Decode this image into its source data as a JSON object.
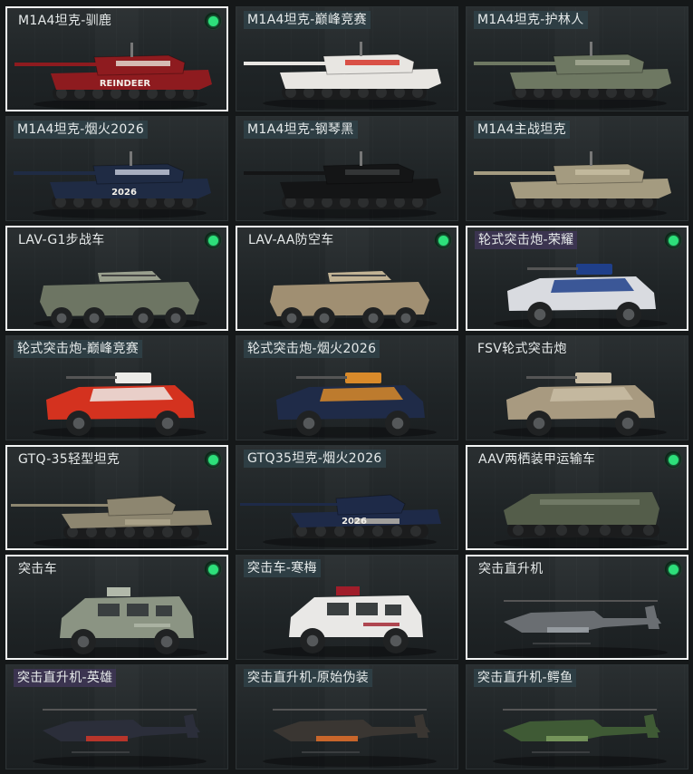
{
  "vehicles": [
    {
      "name": "M1A4坦克-驯鹿",
      "selected": true,
      "owned": true,
      "kind": "tank",
      "body": "#8e1b1f",
      "accent": "#e7e2d8",
      "tag": "plain"
    },
    {
      "name": "M1A4坦克-巅峰竞赛",
      "selected": false,
      "owned": false,
      "kind": "tank",
      "body": "#e8e6e2",
      "accent": "#d52a1f",
      "tag": "tagged"
    },
    {
      "name": "M1A4坦克-护林人",
      "selected": false,
      "owned": false,
      "kind": "tank",
      "body": "#6e7862",
      "accent": "#a7ad97",
      "tag": "tagged"
    },
    {
      "name": "M1A4坦克-烟火2026",
      "selected": false,
      "owned": false,
      "kind": "tank",
      "body": "#1f2b44",
      "accent": "#c9cfe0",
      "tag": "tagged"
    },
    {
      "name": "M1A4坦克-钢琴黑",
      "selected": false,
      "owned": false,
      "kind": "tank",
      "body": "#141516",
      "accent": "#3b3d3f",
      "tag": "tagged"
    },
    {
      "name": "M1A4主战坦克",
      "selected": false,
      "owned": false,
      "kind": "tank",
      "body": "#a49b80",
      "accent": "#c8bfa3",
      "tag": "tagged"
    },
    {
      "name": "LAV-G1步战车",
      "selected": true,
      "owned": true,
      "kind": "wheeled8",
      "body": "#6d7563",
      "accent": "#9aa08e",
      "tag": "plain"
    },
    {
      "name": "LAV-AA防空车",
      "selected": true,
      "owned": true,
      "kind": "wheeled8",
      "body": "#a08f72",
      "accent": "#c2b394",
      "tag": "plain"
    },
    {
      "name": "轮式突击炮-荣耀",
      "selected": true,
      "owned": true,
      "kind": "wheeled4",
      "body": "#d9dbe0",
      "accent": "#1f3f8a",
      "tag": "purple"
    },
    {
      "name": "轮式突击炮-巅峰竞赛",
      "selected": false,
      "owned": false,
      "kind": "wheeled4",
      "body": "#d4321f",
      "accent": "#ecebe8",
      "tag": "tagged"
    },
    {
      "name": "轮式突击炮-烟火2026",
      "selected": false,
      "owned": false,
      "kind": "wheeled4",
      "body": "#1f2b48",
      "accent": "#d98a2a",
      "tag": "tagged"
    },
    {
      "name": "FSV轮式突击炮",
      "selected": false,
      "owned": false,
      "kind": "wheeled4",
      "body": "#a89a80",
      "accent": "#c9bda5",
      "tag": "plain"
    },
    {
      "name": "GTQ-35轻型坦克",
      "selected": true,
      "owned": true,
      "kind": "lighttank",
      "body": "#8d8670",
      "accent": "#b3ab92",
      "tag": "plain"
    },
    {
      "name": "GTQ35坦克-烟火2026",
      "selected": false,
      "owned": false,
      "kind": "lighttank",
      "body": "#1e2a48",
      "accent": "#d9d2c0",
      "tag": "tagged"
    },
    {
      "name": "AAV两栖装甲运输车",
      "selected": true,
      "owned": true,
      "kind": "aav",
      "body": "#545d4a",
      "accent": "#7c8670",
      "tag": "plain"
    },
    {
      "name": "突击车",
      "selected": true,
      "owned": true,
      "kind": "mrap",
      "body": "#8b9483",
      "accent": "#b2b9aa",
      "tag": "plain"
    },
    {
      "name": "突击车-寒梅",
      "selected": false,
      "owned": false,
      "kind": "mrap",
      "body": "#e9e8e6",
      "accent": "#a01d2a",
      "tag": "tagged"
    },
    {
      "name": "突击直升机",
      "selected": true,
      "owned": true,
      "kind": "heli",
      "body": "#6a6e72",
      "accent": "#9aa0a5",
      "tag": "plain"
    },
    {
      "name": "突击直升机-英雄",
      "selected": false,
      "owned": false,
      "kind": "heli",
      "body": "#2b2e3a",
      "accent": "#c8362a",
      "tag": "purple"
    },
    {
      "name": "突击直升机-原始伪装",
      "selected": false,
      "owned": false,
      "kind": "heli",
      "body": "#3a3632",
      "accent": "#d96b2a",
      "tag": "tagged"
    },
    {
      "name": "突击直升机-鳄鱼",
      "selected": false,
      "owned": false,
      "kind": "heli",
      "body": "#3f5a35",
      "accent": "#7a9a5e",
      "tag": "tagged"
    }
  ],
  "overlays": {
    "m1a4_reindeer": "REINDEER",
    "m1a4_fireworks": "2026",
    "gtq35_fireworks": "2026"
  }
}
